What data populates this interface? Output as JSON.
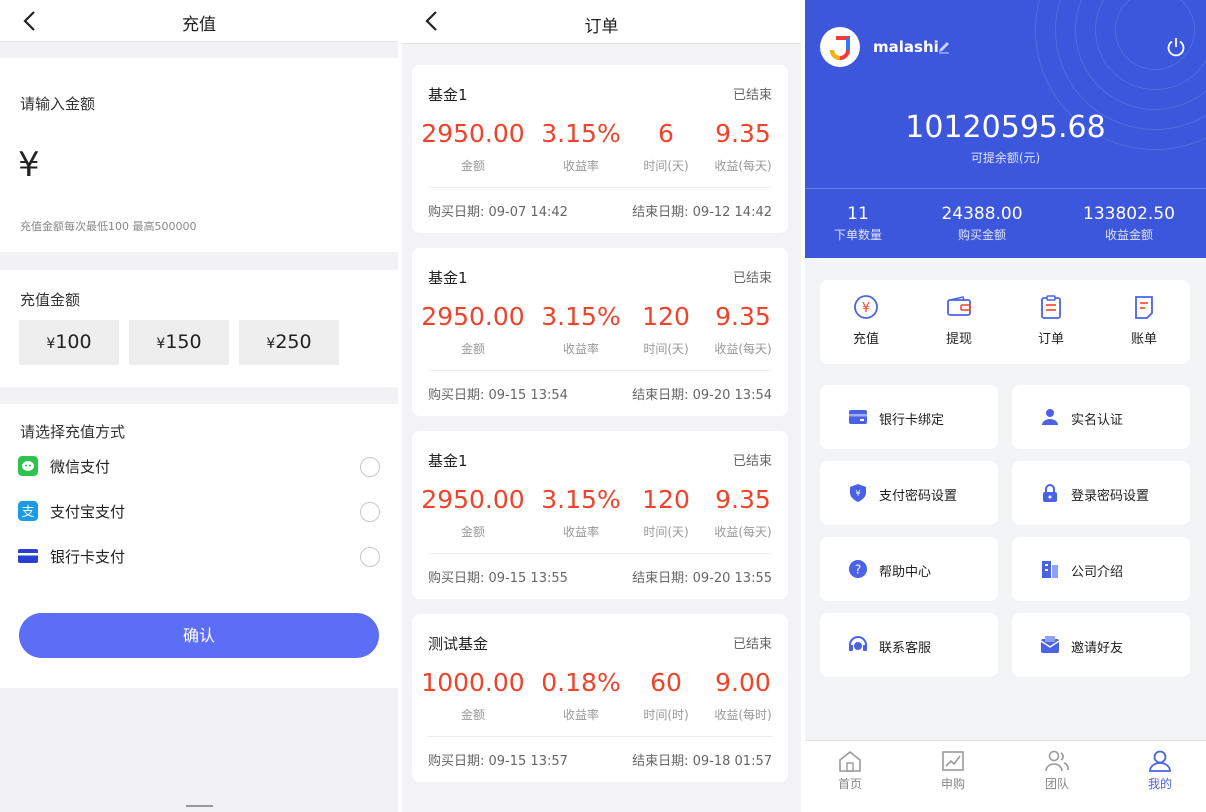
{
  "recharge": {
    "title": "充值",
    "input_label": "请输入金额",
    "currency": "¥",
    "hint": "充值金额每次最低100  最高500000",
    "amount_label": "充值金额",
    "amounts": [
      {
        "symbol": "¥",
        "value": "100"
      },
      {
        "symbol": "¥",
        "value": "150"
      },
      {
        "symbol": "¥",
        "value": "250"
      }
    ],
    "method_label": "请选择充值方式",
    "methods": [
      "微信支付",
      "支付宝支付",
      "银行卡支付"
    ],
    "confirm": "确认"
  },
  "orders": {
    "title": "订单",
    "items": [
      {
        "name": "基金1",
        "status": "已结束",
        "amount": "2950.00",
        "rate": "3.15%",
        "time": "6",
        "profit": "9.35",
        "amount_cap": "金额",
        "rate_cap": "收益率",
        "time_cap": "时间(天)",
        "profit_cap": "收益(每天)",
        "buy_date": "购买日期: 09-07 14:42",
        "end_date": "结束日期: 09-12 14:42"
      },
      {
        "name": "基金1",
        "status": "已结束",
        "amount": "2950.00",
        "rate": "3.15%",
        "time": "120",
        "profit": "9.35",
        "amount_cap": "金额",
        "rate_cap": "收益率",
        "time_cap": "时间(天)",
        "profit_cap": "收益(每天)",
        "buy_date": "购买日期: 09-15 13:54",
        "end_date": "结束日期: 09-20 13:54"
      },
      {
        "name": "基金1",
        "status": "已结束",
        "amount": "2950.00",
        "rate": "3.15%",
        "time": "120",
        "profit": "9.35",
        "amount_cap": "金额",
        "rate_cap": "收益率",
        "time_cap": "时间(天)",
        "profit_cap": "收益(每天)",
        "buy_date": "购买日期: 09-15 13:55",
        "end_date": "结束日期: 09-20 13:55"
      },
      {
        "name": "测试基金",
        "status": "已结束",
        "amount": "1000.00",
        "rate": "0.18%",
        "time": "60",
        "profit": "9.00",
        "amount_cap": "金额",
        "rate_cap": "收益率",
        "time_cap": "时间(时)",
        "profit_cap": "收益(每时)",
        "buy_date": "购买日期: 09-15 13:57",
        "end_date": "结束日期: 09-18 01:57"
      }
    ]
  },
  "profile": {
    "username": "malashi",
    "balance": "10120595.68",
    "balance_label": "可提余额(元)",
    "stats": [
      {
        "value": "11",
        "label": "下单数量"
      },
      {
        "value": "24388.00",
        "label": "购买金额"
      },
      {
        "value": "133802.50",
        "label": "收益金额"
      }
    ],
    "quick": [
      "充值",
      "提现",
      "订单",
      "账单"
    ],
    "menu": [
      "银行卡绑定",
      "实名认证",
      "支付密码设置",
      "登录密码设置",
      "帮助中心",
      "公司介绍",
      "联系客服",
      "邀请好友"
    ],
    "tabs": [
      "首页",
      "申购",
      "团队",
      "我的"
    ],
    "accent": "#3c56dc"
  }
}
